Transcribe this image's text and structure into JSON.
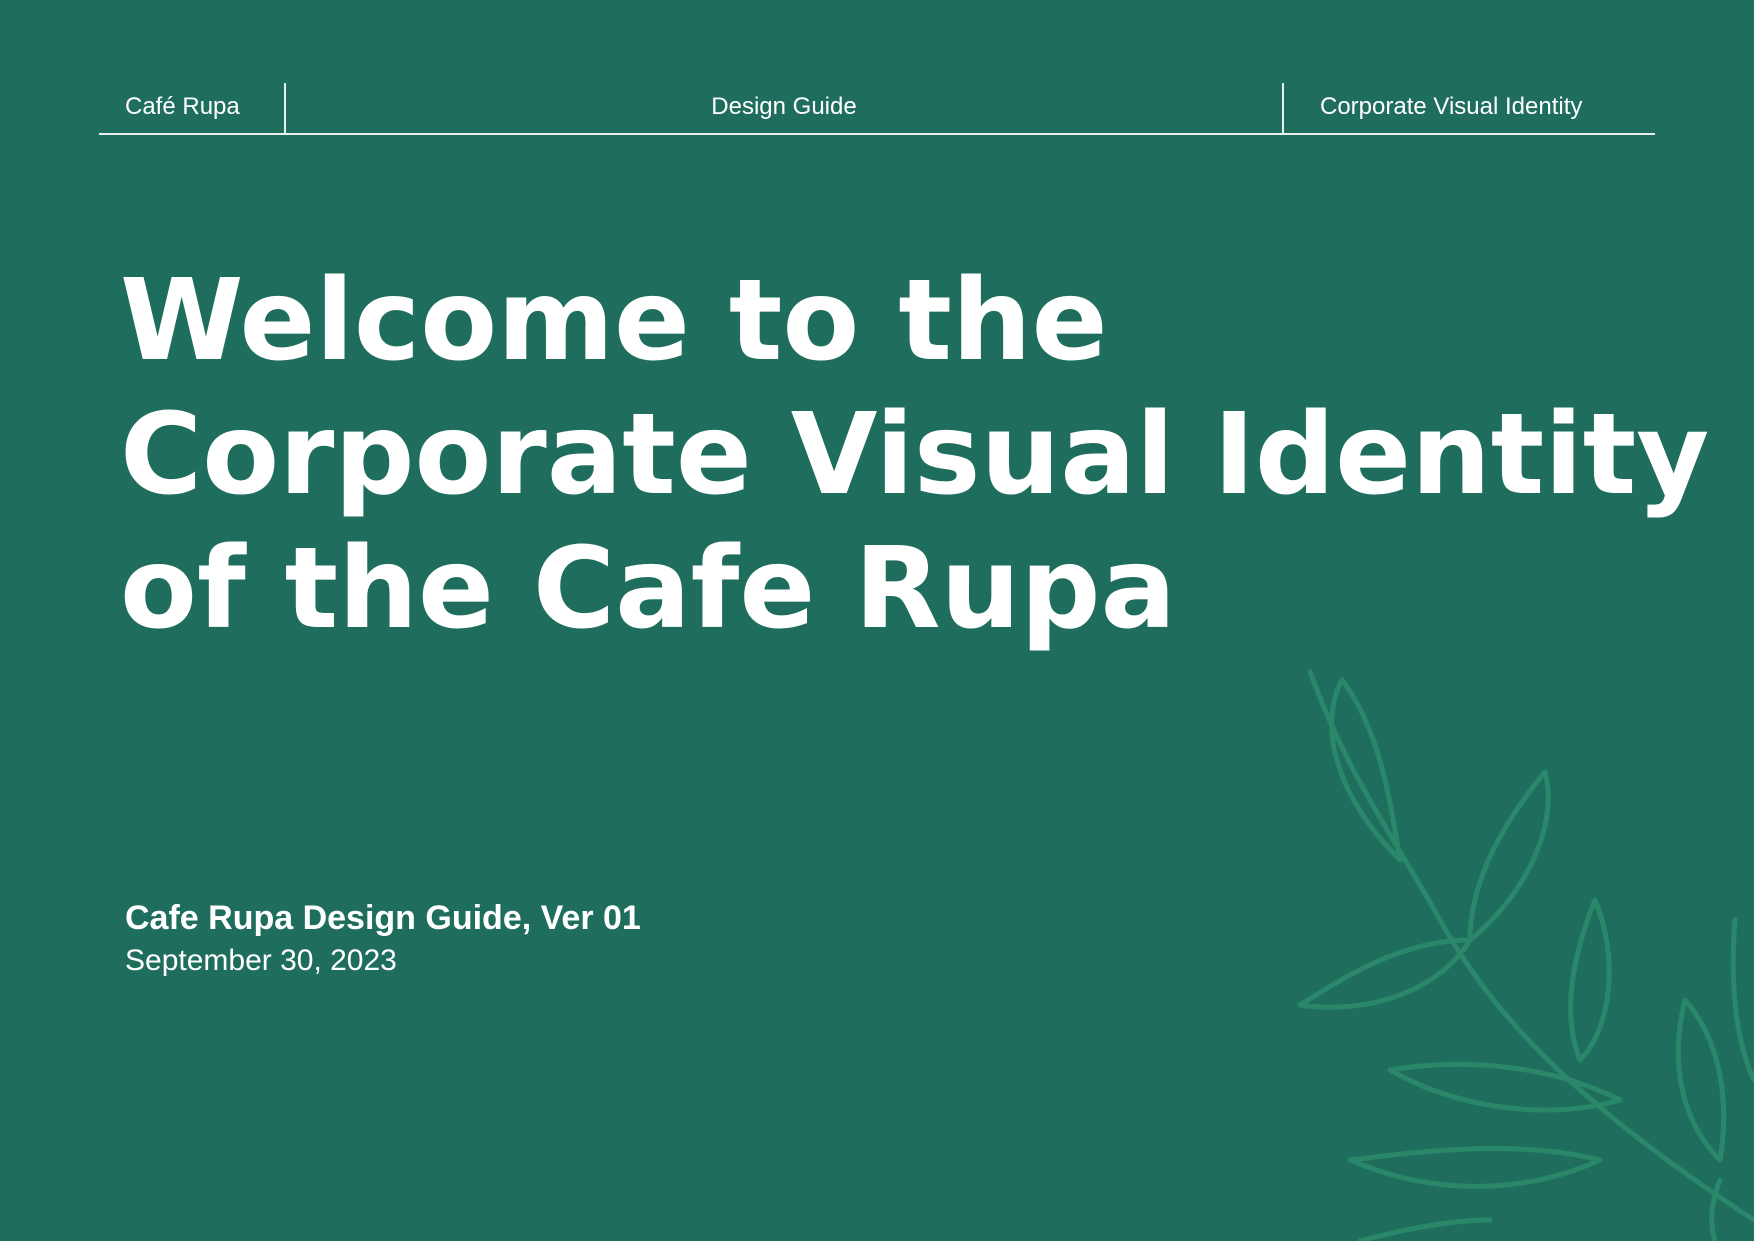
{
  "header": {
    "brand": "Café Rupa",
    "center_title": "Design Guide",
    "right_title": "Corporate Visual Identity"
  },
  "headline": {
    "lines": [
      "Welcome to the",
      "Corporate Visual Identity",
      "of the Cafe Rupa"
    ]
  },
  "meta": {
    "guide_version": "Cafe Rupa Design Guide, Ver 01",
    "date": "September 30, 2023"
  },
  "colors": {
    "background": "#1f6e5d",
    "text": "#ffffff",
    "leaf_illustration": "#2d8c6d"
  },
  "decoration": {
    "illustration": "leaf-branch-icon"
  }
}
